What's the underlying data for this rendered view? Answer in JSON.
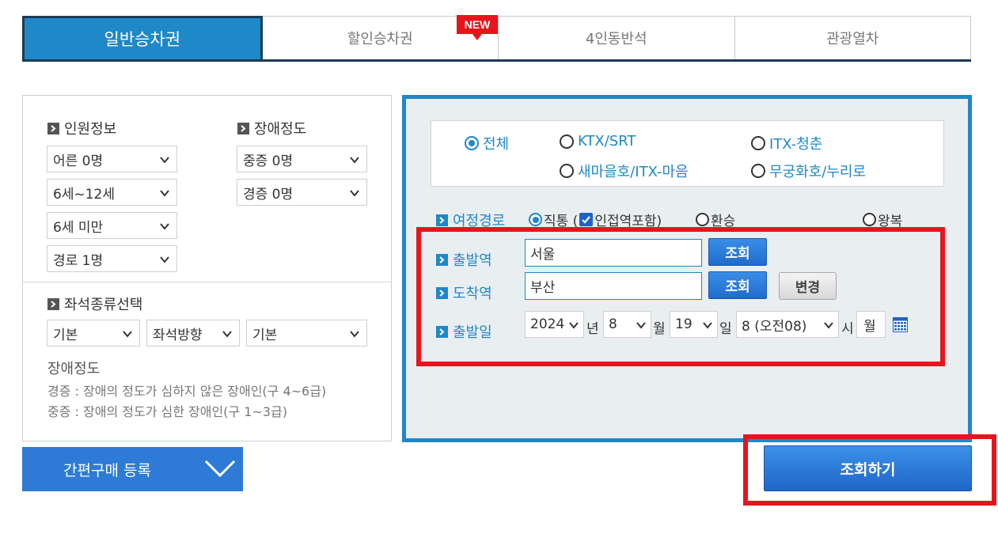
{
  "tabs": [
    {
      "label": "일반승차권",
      "active": true
    },
    {
      "label": "할인승차권",
      "badge": "NEW"
    },
    {
      "label": "4인동반석"
    },
    {
      "label": "관광열차"
    }
  ],
  "passengers": {
    "title": "인원정보",
    "adult": "어른 0명",
    "child": "6세~12세",
    "infant": "6세 미만",
    "senior": "경로 1명"
  },
  "disability": {
    "title": "장애정도",
    "severe": "중증 0명",
    "mild": "경증 0명"
  },
  "seat": {
    "title": "좌석종류선택",
    "type": "기본",
    "direction": "좌석방향",
    "position": "기본"
  },
  "disability_info": {
    "title": "장애정도",
    "mild_desc": "경증 : 장애의 정도가 심하지 않은 장애인(구 4~6급)",
    "severe_desc": "중증 : 장애의 정도가 심한 장애인(구 1~3급)"
  },
  "train_types": {
    "all": "전체",
    "ktx": "KTX/SRT",
    "itx": "ITX-청춘",
    "saemaeul": "새마을호/ITX-마음",
    "mugunghwa": "무궁화호/누리로",
    "selected": "전체"
  },
  "route": {
    "label": "여정경로",
    "direct": "직통 (",
    "adjacent": "인접역포함)",
    "transfer": "환승",
    "roundtrip": "왕복"
  },
  "departure": {
    "label": "출발역",
    "value": "서울",
    "lookup": "조회"
  },
  "arrival": {
    "label": "도착역",
    "value": "부산",
    "lookup": "조회",
    "swap": "변경"
  },
  "date": {
    "label": "출발일",
    "year": "2024",
    "year_unit": "년",
    "month": "8",
    "month_unit": "월",
    "day": "19",
    "day_unit": "일",
    "hour": "8 (오전08)",
    "hour_unit": "시",
    "weekday": "월"
  },
  "quick_purchase": "간편구매 등록",
  "search_button": "조회하기",
  "colors": {
    "accent": "#1e88c8",
    "highlight": "#e8141c",
    "button": "#1f6ccd"
  }
}
